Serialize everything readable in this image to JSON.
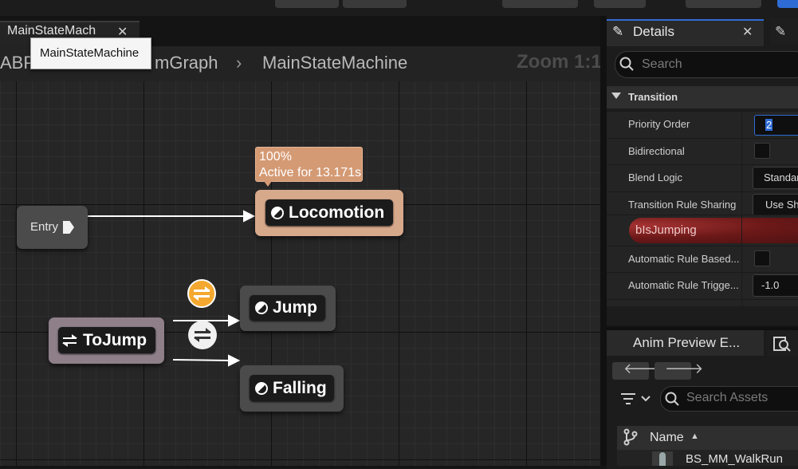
{
  "document_tab": {
    "label": "MainStateMach",
    "tooltip": "MainStateMachine"
  },
  "breadcrumb": {
    "partial": "ABP",
    "parent": "mGraph",
    "current": "MainStateMachine"
  },
  "graph": {
    "zoom": "Zoom 1:1",
    "entry_label": "Entry",
    "states": {
      "locomotion": "Locomotion",
      "jump": "Jump",
      "falling": "Falling"
    },
    "conduit": "ToJump",
    "status": {
      "percent": "100%",
      "active": "Active for 13.171s"
    }
  },
  "details": {
    "title": "Details",
    "search_placeholder": "Search",
    "category": "Transition",
    "properties": {
      "priority_order": {
        "label": "Priority Order",
        "value": "2"
      },
      "bidirectional": {
        "label": "Bidirectional"
      },
      "blend_logic": {
        "label": "Blend Logic",
        "value": "Standard"
      },
      "rule_sharing": {
        "label": "Transition Rule Sharing",
        "value": "Use Sh"
      },
      "rule_variable": "bIsJumping",
      "auto_rule_based": {
        "label": "Automatic Rule Based..."
      },
      "auto_rule_trigger": {
        "label": "Automatic Rule Trigge...",
        "value": "-1.0"
      }
    }
  },
  "anim_preview": {
    "title": "Anim Preview E...",
    "search_placeholder": "Search Assets",
    "column_name": "Name",
    "asset": "BS_MM_WalkRun"
  },
  "colors": {
    "accent": "#2f6bd4",
    "locomotion": "#d7a98b",
    "conduit": "#8e7f88",
    "rule": "#6b1818"
  }
}
